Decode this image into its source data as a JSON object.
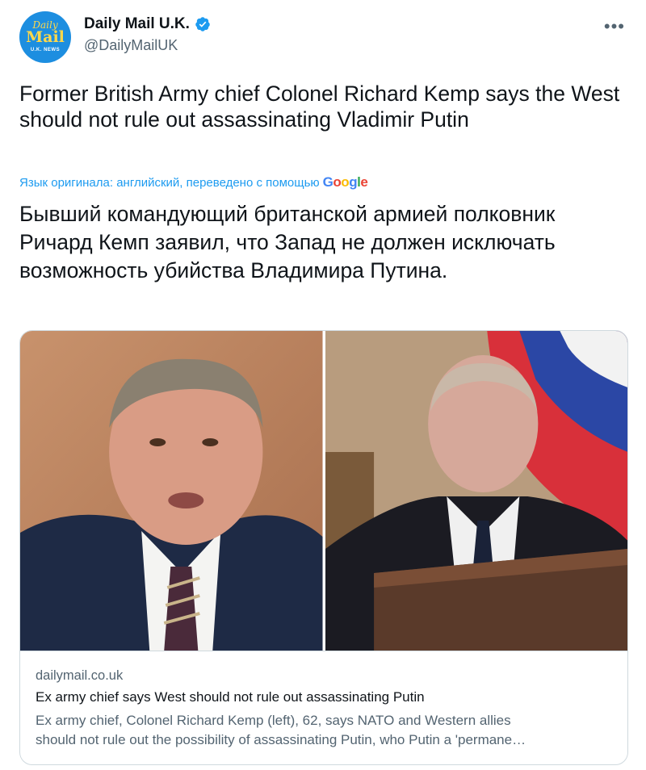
{
  "author": {
    "display_name": "Daily Mail U.K.",
    "handle": "@DailyMailUK",
    "avatar_text": {
      "top": "Daily",
      "main": "Mail",
      "bottom": "U.K. NEWS"
    },
    "verified_icon": "verified-badge-icon",
    "verified_color": "#1d9bf0"
  },
  "more_icon": "more-options-icon",
  "tweet": {
    "original_text": "Former British Army chief Colonel Richard Kemp says the West should not rule out assassinating Vladimir Putin",
    "translation_note": "Язык оригинала: английский, переведено с помощью",
    "translation_provider": "Google",
    "translated_text": "Бывший командующий британской армией полковник Ричард Кемп заявил, что Запад не должен исключать возможность убийства Владимира Путина."
  },
  "link_card": {
    "domain": "dailymail.co.uk",
    "title": "Ex army chief says West should not rule out assassinating Putin",
    "description_line1": "Ex army chief, Colonel Richard Kemp (left), 62, says NATO and Western allies",
    "description_line2": "should not rule out the possibility of assassinating Putin, who Putin a 'permane…"
  },
  "colors": {
    "accent": "#1d9bf0",
    "secondary_text": "#536471",
    "primary_text": "#0f1419",
    "border": "#cfd9de"
  }
}
